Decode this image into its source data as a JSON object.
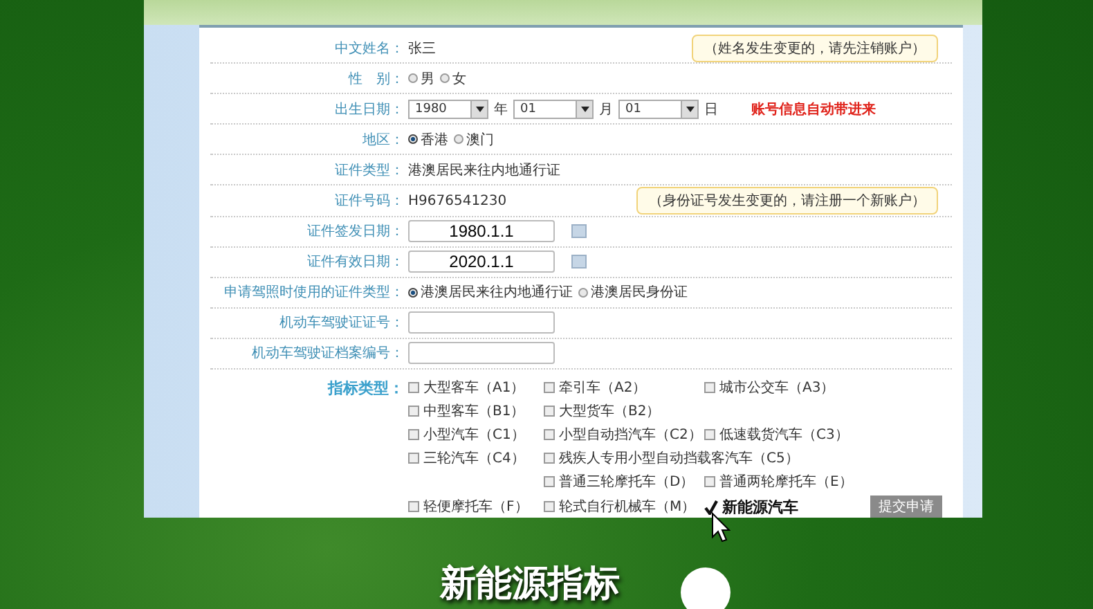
{
  "form": {
    "rows": [
      {
        "kind": "text",
        "label": "中文姓名：",
        "value": "张三",
        "note": "（姓名发生变更的，请先注销账户）"
      },
      {
        "kind": "radio",
        "label": "性　别：",
        "options": [
          {
            "label": "男",
            "selected": false
          },
          {
            "label": "女",
            "selected": false
          }
        ]
      },
      {
        "kind": "birth",
        "label": "出生日期：",
        "parts": [
          {
            "value": "1980",
            "unit": "年"
          },
          {
            "value": "01",
            "unit": "月"
          },
          {
            "value": "01",
            "unit": "日"
          }
        ],
        "alert": "账号信息自动带进来"
      },
      {
        "kind": "radio",
        "label": "地区：",
        "options": [
          {
            "label": "香港",
            "selected": true
          },
          {
            "label": "澳门",
            "selected": false
          }
        ]
      },
      {
        "kind": "text",
        "label": "证件类型：",
        "value": "港澳居民来往内地通行证"
      },
      {
        "kind": "text",
        "label": "证件号码：",
        "value": "H9676541230",
        "note": "（身份证号发生变更的，请注册一个新账户）"
      },
      {
        "kind": "date",
        "label": "证件签发日期：",
        "value": "1980.1.1"
      },
      {
        "kind": "date",
        "label": "证件有效日期：",
        "value": "2020.1.1"
      },
      {
        "kind": "radio",
        "label": "申请驾照时使用的证件类型：",
        "options": [
          {
            "label": "港澳居民来往内地通行证",
            "selected": true
          },
          {
            "label": "港澳居民身份证",
            "selected": false
          }
        ]
      },
      {
        "kind": "input",
        "label": "机动车驾驶证证号："
      },
      {
        "kind": "input",
        "label": "机动车驾驶证档案编号："
      }
    ],
    "indicator": {
      "label": "指标类型：",
      "rows": [
        {
          "cells": [
            {
              "label": "大型客车（A1）",
              "checked": false
            },
            {
              "label": "牵引车（A2）",
              "checked": false
            },
            {
              "label": "城市公交车（A3）",
              "checked": false
            }
          ]
        },
        {
          "cells": [
            {
              "label": "中型客车（B1）",
              "checked": false
            },
            {
              "label": "大型货车（B2）",
              "checked": false
            },
            null
          ]
        },
        {
          "cells": [
            {
              "label": "小型汽车（C1）",
              "checked": false
            },
            {
              "label": "小型自动挡汽车（C2）",
              "checked": false
            },
            {
              "label": "低速载货汽车（C3）",
              "checked": false
            }
          ]
        },
        {
          "cells": [
            {
              "label": "三轮汽车（C4）",
              "checked": false
            },
            {
              "label": "残疾人专用小型自动挡载客汽车（C5）",
              "checked": false
            },
            null
          ]
        },
        {
          "cells": [
            null,
            {
              "label": "普通三轮摩托车（D）",
              "checked": false
            },
            {
              "label": "普通两轮摩托车（E）",
              "checked": false
            }
          ]
        },
        {
          "cells": [
            {
              "label": "轻便摩托车（F）",
              "checked": false
            },
            {
              "label": "轮式自行机械车（M）",
              "checked": false
            },
            {
              "label": "新能源汽车",
              "checked": true
            }
          ]
        }
      ],
      "submit": "提交申请"
    }
  },
  "caption": "新能源指标"
}
